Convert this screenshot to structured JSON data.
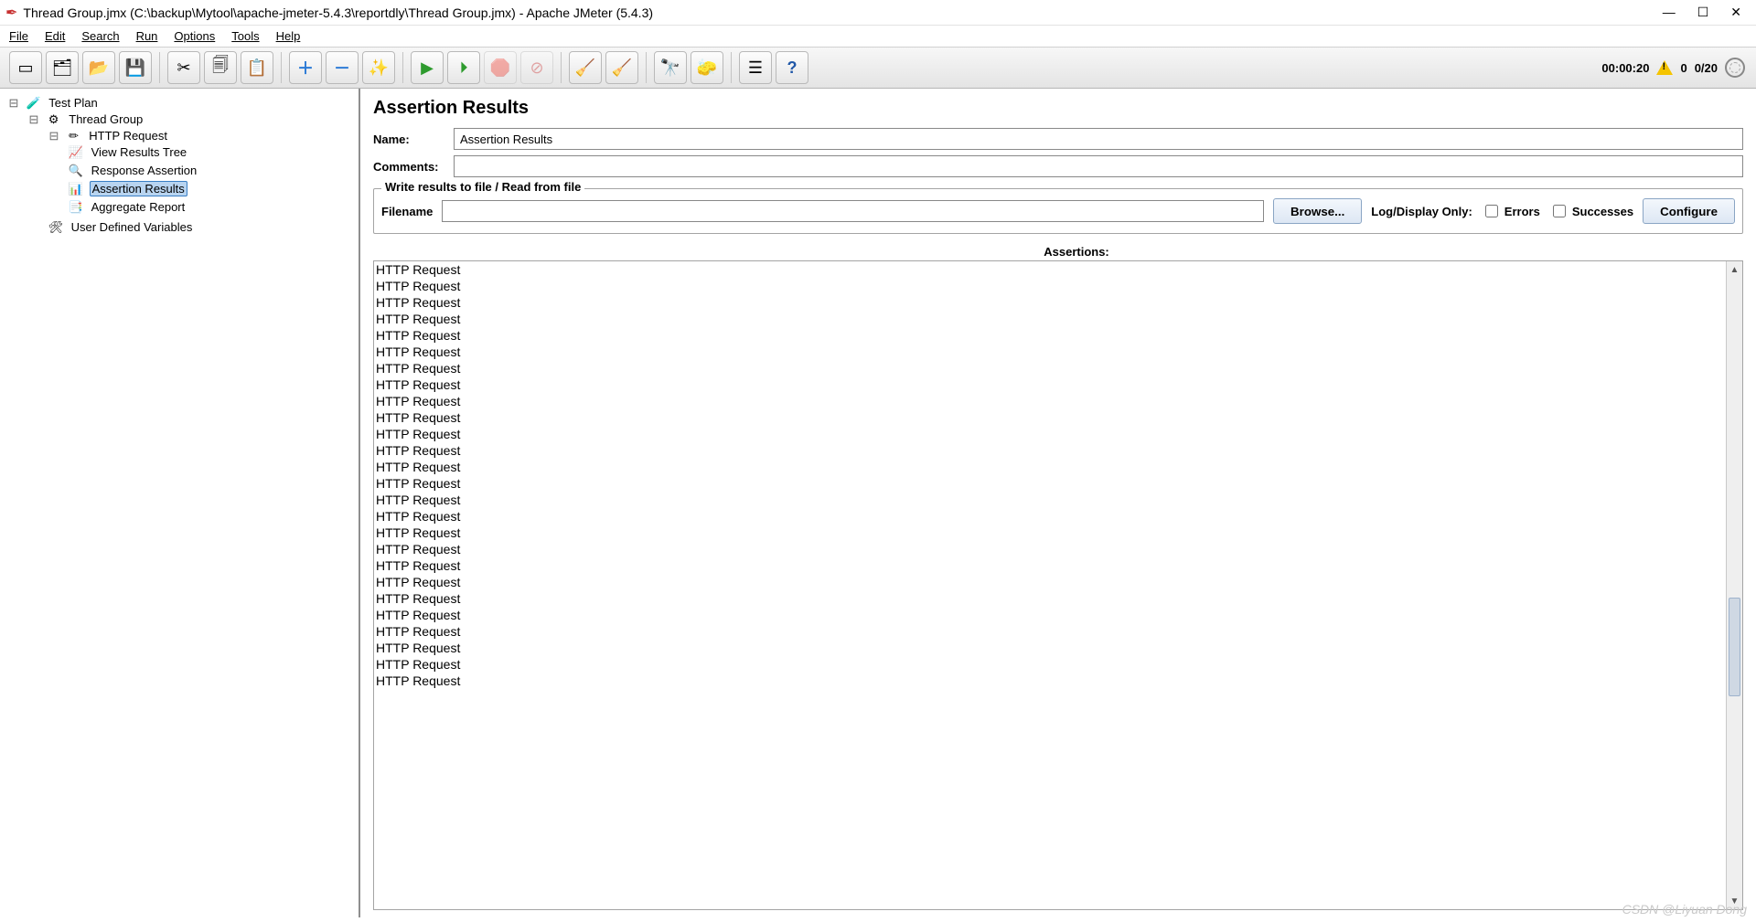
{
  "window": {
    "title": "Thread Group.jmx (C:\\backup\\Mytool\\apache-jmeter-5.4.3\\reportdly\\Thread Group.jmx) - Apache JMeter (5.4.3)"
  },
  "menu": [
    "File",
    "Edit",
    "Search",
    "Run",
    "Options",
    "Tools",
    "Help"
  ],
  "toolbar": {
    "status": {
      "time": "00:00:20",
      "warn_count": "0",
      "threads": "0/20"
    }
  },
  "tree": {
    "root": {
      "label": "Test Plan"
    },
    "tg": {
      "label": "Thread Group"
    },
    "http": {
      "label": "HTTP Request"
    },
    "vrt": {
      "label": "View Results Tree"
    },
    "ra": {
      "label": "Response Assertion"
    },
    "ar": {
      "label": "Assertion Results"
    },
    "agg": {
      "label": "Aggregate Report"
    },
    "udv": {
      "label": "User Defined Variables"
    }
  },
  "panel": {
    "heading": "Assertion Results",
    "name_lbl": "Name:",
    "name_val": "Assertion Results",
    "comments_lbl": "Comments:",
    "comments_val": "",
    "file_legend": "Write results to file / Read from file",
    "filename_lbl": "Filename",
    "filename_val": "",
    "browse_btn": "Browse...",
    "logdisplay_lbl": "Log/Display Only:",
    "errors_lbl": "Errors",
    "successes_lbl": "Successes",
    "configure_btn": "Configure",
    "assertions_header": "Assertions:",
    "assertions": [
      "HTTP Request",
      "HTTP Request",
      "HTTP Request",
      "HTTP Request",
      "HTTP Request",
      "HTTP Request",
      "HTTP Request",
      "HTTP Request",
      "HTTP Request",
      "HTTP Request",
      "HTTP Request",
      "HTTP Request",
      "HTTP Request",
      "HTTP Request",
      "HTTP Request",
      "HTTP Request",
      "HTTP Request",
      "HTTP Request",
      "HTTP Request",
      "HTTP Request",
      "HTTP Request",
      "HTTP Request",
      "HTTP Request",
      "HTTP Request",
      "HTTP Request",
      "HTTP Request"
    ]
  },
  "watermark": "CSDN @Liyuan Dong"
}
